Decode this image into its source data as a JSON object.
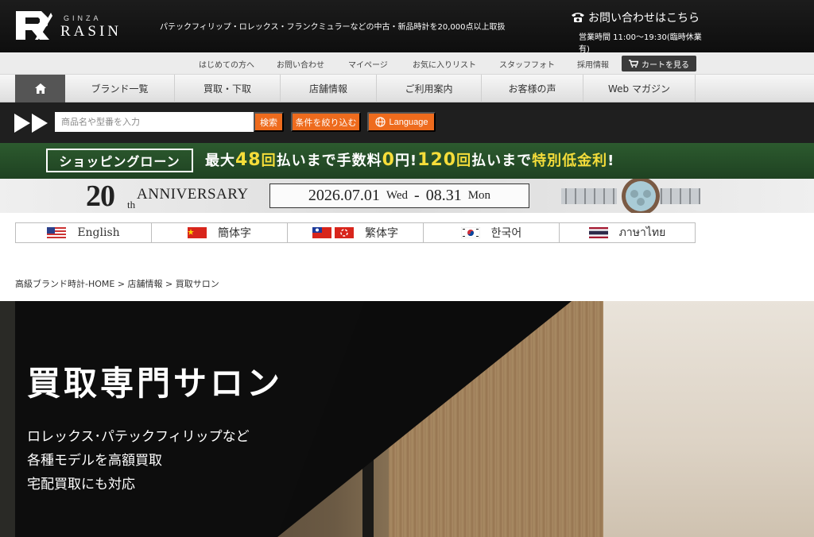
{
  "header": {
    "logo_small": "GINZA",
    "logo_big": "RASIN",
    "tagline": "パテックフィリップ・ロレックス・フランクミュラーなどの中古・新品時計を20,000点以上取扱",
    "contact_label": "お問い合わせはこちら",
    "hours": "営業時間 11:00～19:30(臨時休業有)"
  },
  "utility_nav": {
    "items": [
      "はじめての方へ",
      "お問い合わせ",
      "マイページ",
      "お気に入りリスト",
      "スタッフフォト",
      "採用情報"
    ],
    "cart_label": "カートを見る"
  },
  "main_nav": {
    "items": [
      "ブランド一覧",
      "買取・下取",
      "店舗情報",
      "ご利用案内",
      "お客様の声",
      "Web マガジン"
    ]
  },
  "search": {
    "placeholder": "商品名や型番を入力",
    "search_label": "検索",
    "filter_label": "条件を絞り込む",
    "language_label": "Language"
  },
  "loan_banner": {
    "box_label": "ショッピングローン",
    "t1": "最大",
    "n1": "48",
    "t2": "回",
    "t3": "払いまで手数料",
    "n2": "0",
    "t4": "円!",
    "n3": "120",
    "t5": "回",
    "t6": "払いまで",
    "t7": "特別低金利",
    "t8": "!"
  },
  "anniversary": {
    "number": "20",
    "suffix": "th",
    "word": "ANNIVERSARY",
    "start": "2026.07.01",
    "start_day": "Wed",
    "sep": "-",
    "end": "08.31",
    "end_day": "Mon"
  },
  "languages": [
    {
      "label": "English"
    },
    {
      "label": "簡体字"
    },
    {
      "label": "繁体字"
    },
    {
      "label": "한국어"
    },
    {
      "label": "ภาษาไทย"
    }
  ],
  "breadcrumb": "高級ブランド時計-HOME > 店舗情報 > 買取サロン",
  "hero": {
    "title": "買取専門サロン",
    "line1": "ロレックス･パテックフィリップなど",
    "line2": "各種モデルを高額買取",
    "line3": "宅配買取にも対応"
  },
  "colors": {
    "accent_orange": "#ee6b1d",
    "loan_green": "#2c5a2e",
    "loan_yellow": "#f5dd3a",
    "header_black": "#111111"
  },
  "icons": {
    "home": "home-icon",
    "phone": "phone-icon",
    "cart": "cart-icon",
    "globe": "globe-icon"
  }
}
